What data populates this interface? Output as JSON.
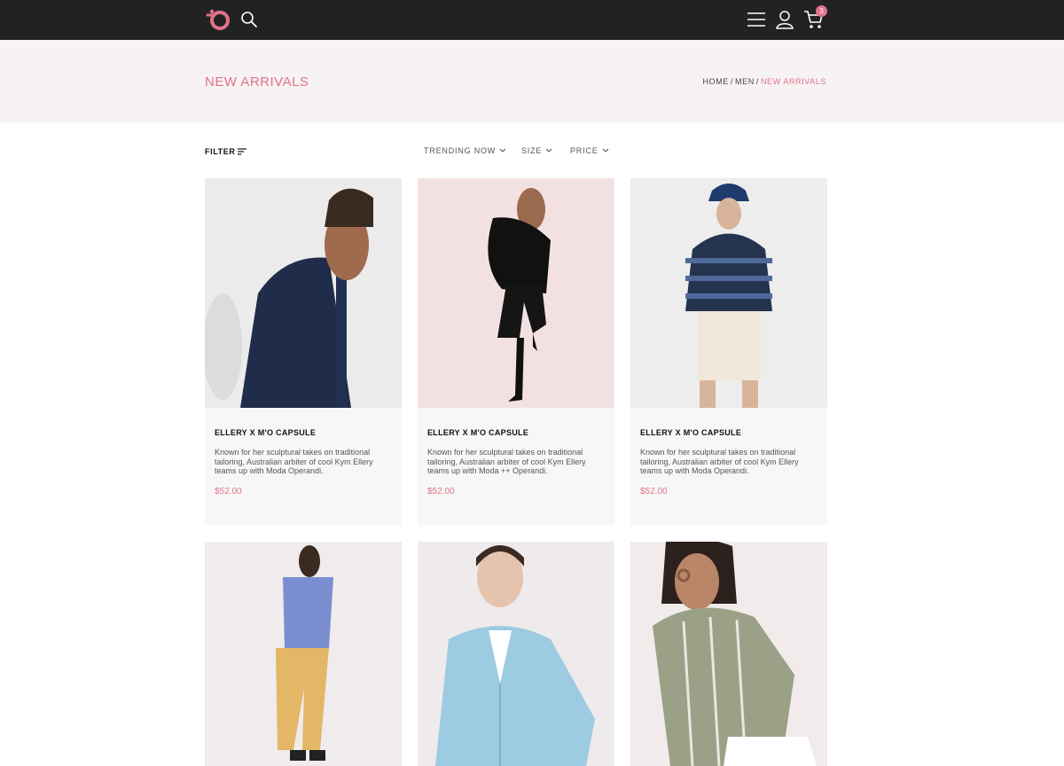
{
  "header": {
    "logo": "logo",
    "icons": [
      "search-icon",
      "hamburger-menu-icon",
      "user-icon",
      "cart-icon"
    ],
    "cart_count": "3"
  },
  "hero": {
    "title": "NEW ARRIVALS",
    "breadcrumb": [
      "HOME",
      "MEN",
      "NEW ARRIVALS"
    ]
  },
  "filters": {
    "filter_label": "FILTER",
    "dropdowns": [
      "TRENDING NOW",
      "SIZE",
      "PRICE"
    ]
  },
  "products": [
    {
      "name": "ELLERY X M'O CAPSULE",
      "description": "Known for her sculptural takes on traditional tailoring, Australian arbiter of cool Kym Ellery teams up with Moda Operandi.",
      "price": "$52.00"
    },
    {
      "name": "ELLERY X M'O CAPSULE",
      "description": "Known for her sculptural takes on traditional tailoring, Australian arbiter of cool Kym Ellery teams up with Moda ++ Operandi.",
      "price": "$52.00"
    },
    {
      "name": "ELLERY X M'O CAPSULE",
      "description": "Known for her sculptural takes on traditional tailoring, Australian arbiter of cool Kym Ellery teams up with Moda Operandi.",
      "price": "$52.00"
    }
  ],
  "colors": {
    "topbar": "#222222",
    "accent": "#e0728a",
    "hero_bg": "#f7f3f4",
    "card_bg": "#f7f7f7"
  }
}
